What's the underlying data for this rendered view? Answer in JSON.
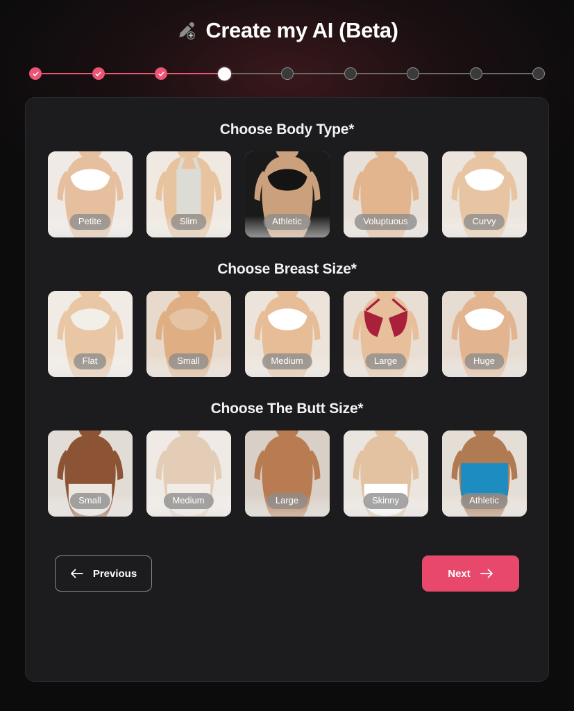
{
  "header": {
    "title": "Create my AI (Beta)",
    "icon": "pencil-plus-icon"
  },
  "stepper": {
    "total_steps": 9,
    "current_step": 4,
    "completed_color": "#ec5575",
    "active_color": "#ffffff",
    "pending_color": "#3a3a3a",
    "steps": [
      {
        "state": "done"
      },
      {
        "state": "done"
      },
      {
        "state": "done"
      },
      {
        "state": "active"
      },
      {
        "state": "todo"
      },
      {
        "state": "todo"
      },
      {
        "state": "todo"
      },
      {
        "state": "todo"
      },
      {
        "state": "todo"
      }
    ]
  },
  "sections": [
    {
      "title": "Choose Body Type*",
      "name": "body-type",
      "options": [
        {
          "label": "Petite",
          "skin": "#e6bf9e",
          "bg": "#efeae6",
          "garment": "#ffffff",
          "style": "bra"
        },
        {
          "label": "Slim",
          "skin": "#e8c39f",
          "bg": "#efe9e1",
          "garment": "#dcdcd4",
          "style": "tank"
        },
        {
          "label": "Athletic",
          "skin": "#caa17c",
          "bg": "#1a1a1a",
          "garment": "#141414",
          "style": "sports-bra"
        },
        {
          "label": "Voluptuous",
          "skin": "#e3b58e",
          "bg": "#e7e0d8",
          "garment": "#e9cfb4",
          "style": "nude"
        },
        {
          "label": "Curvy",
          "skin": "#e8c5a2",
          "bg": "#ece5dd",
          "garment": "#ffffff",
          "style": "bra"
        }
      ]
    },
    {
      "title": "Choose Breast Size*",
      "name": "breast-size",
      "options": [
        {
          "label": "Flat",
          "skin": "#e9c6a4",
          "bg": "#f0ebe5",
          "garment": "#f2eee8",
          "style": "bra"
        },
        {
          "label": "Small",
          "skin": "#dfae82",
          "bg": "#e7dacd",
          "garment": "#e4c4a4",
          "style": "bra"
        },
        {
          "label": "Medium",
          "skin": "#e6bd97",
          "bg": "#ece4da",
          "garment": "#ffffff",
          "style": "bra"
        },
        {
          "label": "Large",
          "skin": "#e7bf9b",
          "bg": "#e9ded3",
          "garment": "#a8203a",
          "style": "bikini"
        },
        {
          "label": "Huge",
          "skin": "#e2b48f",
          "bg": "#e6dcd2",
          "garment": "#ffffff",
          "style": "bra"
        }
      ]
    },
    {
      "title": "Choose The Butt Size*",
      "name": "butt-size",
      "options": [
        {
          "label": "Small",
          "skin": "#8c5434",
          "bg": "#e2dcd6",
          "garment": "#ece6df",
          "style": "brief"
        },
        {
          "label": "Medium",
          "skin": "#e4cdb6",
          "bg": "#efeae5",
          "garment": "#f2ece6",
          "style": "brief"
        },
        {
          "label": "Large",
          "skin": "#b87b52",
          "bg": "#d8cfc6",
          "garment": "#c79a74",
          "style": "nude"
        },
        {
          "label": "Skinny",
          "skin": "#e3c2a1",
          "bg": "#ebe5df",
          "garment": "#ffffff",
          "style": "brief"
        },
        {
          "label": "Athletic",
          "skin": "#b07a52",
          "bg": "#e5ded6",
          "garment": "#1d8cc0",
          "style": "shorts"
        }
      ]
    }
  ],
  "footer": {
    "previous_label": "Previous",
    "next_label": "Next",
    "next_color": "#e8486b"
  }
}
